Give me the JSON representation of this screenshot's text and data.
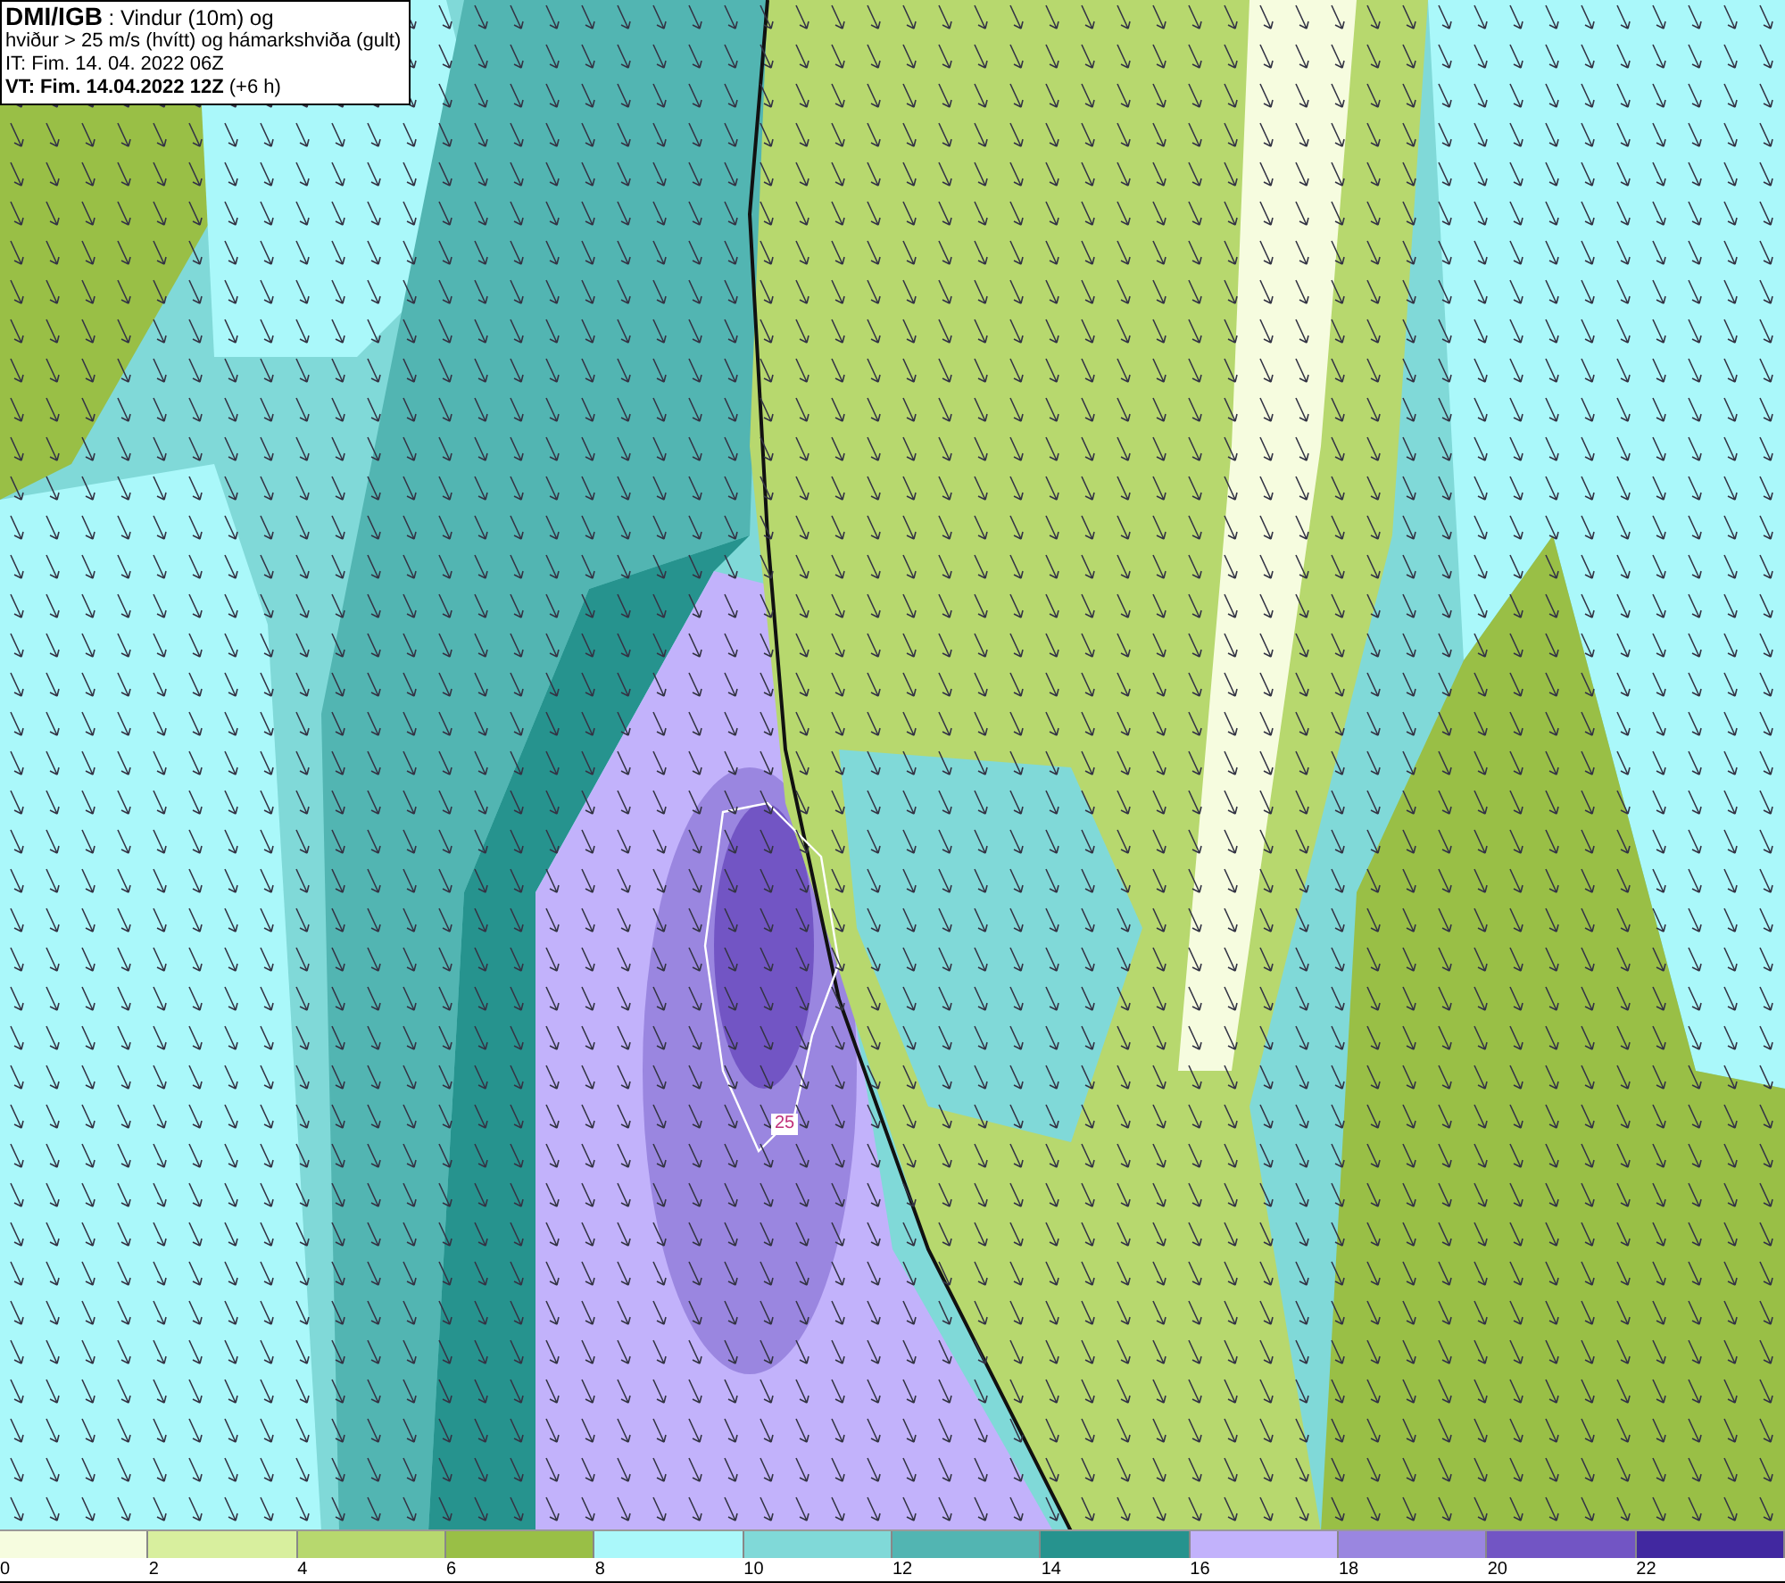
{
  "header": {
    "lines": [
      "**DMI/IGB** : Vindur (10m) og",
      "hviður > 25 m/s (hvítt) og hámarkshviða (gult)",
      "IT: Fim. 14. 04. 2022 06Z",
      "**VT: Fim. 14.04.2022 12Z** (+6 h)"
    ]
  },
  "map": {
    "contour_label": "25"
  },
  "legend": {
    "bins": [
      {
        "color": "#f6fcdf"
      },
      {
        "color": "#d8ef9e"
      },
      {
        "color": "#b7d86e"
      },
      {
        "color": "#99bf46"
      },
      {
        "color": "#aaf8fa"
      },
      {
        "color": "#80d9d8"
      },
      {
        "color": "#52b5b2"
      },
      {
        "color": "#26938e"
      },
      {
        "color": "#c2b2fb"
      },
      {
        "color": "#9a86e0"
      },
      {
        "color": "#7255c4"
      },
      {
        "color": "#4128a0"
      }
    ],
    "ticks": [
      "0",
      "2",
      "4",
      "6",
      "8",
      "10",
      "12",
      "14",
      "16",
      "18",
      "20",
      "22"
    ]
  }
}
